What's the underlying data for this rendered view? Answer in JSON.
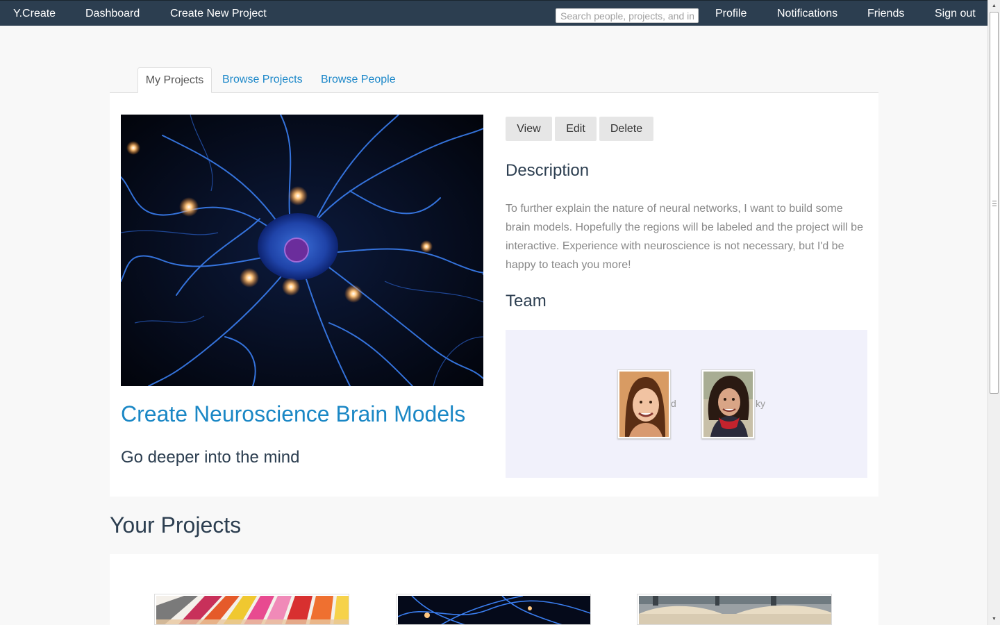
{
  "navbar": {
    "brand": "Y.Create",
    "dashboard": "Dashboard",
    "create_project": "Create New Project",
    "search_placeholder": "Search people, projects, and interests",
    "profile": "Profile",
    "notifications": "Notifications",
    "friends": "Friends",
    "sign_out": "Sign out"
  },
  "tabs": {
    "my_projects": "My Projects",
    "browse_projects": "Browse Projects",
    "browse_people": "Browse People"
  },
  "project": {
    "title": "Create Neuroscience Brain Models",
    "subtitle": "Go deeper into the mind",
    "actions": {
      "view": "View",
      "edit": "Edit",
      "delete": "Delete"
    },
    "description_heading": "Description",
    "description": "To further explain the nature of neural networks, I want to build some brain models. Hopefully the regions will be labeled and the project will be interactive. Experience with neuroscience is not necessary, but I'd be happy to teach you more!",
    "team_heading": "Team",
    "team": [
      {
        "name_tail": "d"
      },
      {
        "name_tail": "ky"
      }
    ]
  },
  "your_projects": {
    "heading": "Your Projects"
  },
  "colors": {
    "navbar": "#2c3e50",
    "link": "#1a87c5",
    "team_bg": "#f1f1fb"
  }
}
